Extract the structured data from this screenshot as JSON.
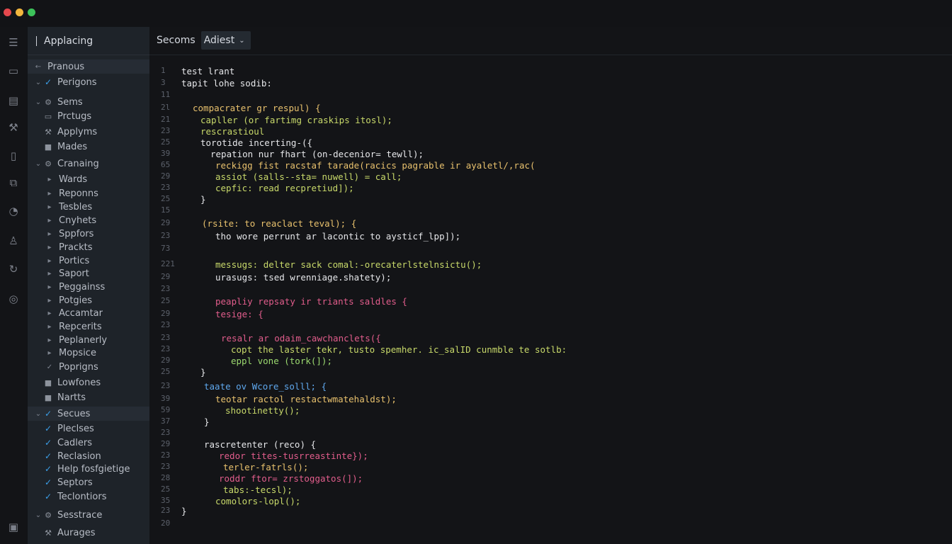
{
  "colors": {
    "close": "#e5484d",
    "minimize": "#f2b63d",
    "maximize": "#3cc25a",
    "accent": "#3b9fe8"
  },
  "sidebar": {
    "title": "Applacing",
    "items": [
      {
        "label": "Pranous",
        "glyph": "←",
        "check": false
      },
      {
        "label": "Perigons",
        "glyph": "⌄",
        "check": true
      },
      {
        "label": "Sems",
        "glyph": "⌄",
        "icon": "gear-icon"
      },
      {
        "label": "Prctugs",
        "icon": "folder-icon"
      },
      {
        "label": "Applyms",
        "icon": "wrench-icon"
      },
      {
        "label": "Mades",
        "icon": "box-icon"
      },
      {
        "label": "Cranaing",
        "glyph": "⌄",
        "icon": "gear-icon"
      },
      {
        "label": "Wards",
        "glyph": "▸"
      },
      {
        "label": "Reponns",
        "glyph": "▸"
      },
      {
        "label": "Tesbles",
        "glyph": "▸"
      },
      {
        "label": "Cnyhets",
        "glyph": "▸"
      },
      {
        "label": "Sppfors",
        "glyph": "▸"
      },
      {
        "label": "Prackts",
        "glyph": "▸"
      },
      {
        "label": "Portics",
        "glyph": "▸"
      },
      {
        "label": "Saport",
        "glyph": "▸"
      },
      {
        "label": "Peggainss",
        "glyph": "▸"
      },
      {
        "label": "Potgies",
        "glyph": "▸"
      },
      {
        "label": "Accamtar",
        "glyph": "▸"
      },
      {
        "label": "Repcerits",
        "glyph": "▸"
      },
      {
        "label": "Peplanerly",
        "glyph": "▸"
      },
      {
        "label": "Mopsice",
        "glyph": "▸"
      },
      {
        "label": "Poprigns",
        "glyph": "✓"
      },
      {
        "label": "Lowfones",
        "icon": "box-icon"
      },
      {
        "label": "Nartts",
        "icon": "box-icon"
      },
      {
        "label": "Secues",
        "glyph": "⌄",
        "check": true
      },
      {
        "label": "Pleclses",
        "check": true
      },
      {
        "label": "Cadlers",
        "check": true
      },
      {
        "label": "Reclasion",
        "check": true
      },
      {
        "label": "Help fosfgietige",
        "check": true
      },
      {
        "label": "Septors",
        "check": true
      },
      {
        "label": "Teclontiors",
        "check": true
      },
      {
        "label": "Sesstrace",
        "glyph": "⌄",
        "icon": "gear-icon"
      },
      {
        "label": "Aurages",
        "icon": "wrench-icon"
      }
    ]
  },
  "editor": {
    "tabs": [
      {
        "label": "Secoms"
      },
      {
        "label": "Adiest"
      }
    ],
    "lines": [
      {
        "n": "1",
        "t": "test lrant"
      },
      {
        "n": "3",
        "t": "tapit lohe sodib:"
      },
      {
        "n": "11",
        "t": ""
      },
      {
        "n": "2l",
        "t": "compacrater gr respul) {"
      },
      {
        "n": "21",
        "t": "capller (or fartimg craskips itosl);"
      },
      {
        "n": "23",
        "t": "rescrastioul"
      },
      {
        "n": "25",
        "t": "torotide incerting-({"
      },
      {
        "n": "39",
        "t": "repation nur fhart (on-decenior= tewll);"
      },
      {
        "n": "65",
        "t": "reckigg fist racstaf tarade(racics pagrable ir ayaletl/,rac("
      },
      {
        "n": "29",
        "t": "assiot (salls--sta= nuwell) = call;"
      },
      {
        "n": "23",
        "t": "cepfic: read recpretiud]);"
      },
      {
        "n": "25",
        "t": "}"
      },
      {
        "n": "15",
        "t": ""
      },
      {
        "n": "29",
        "t": "(rsite: to reaclact teval); {"
      },
      {
        "n": "23",
        "t": "tho wore perrunt ar lacontic to aysticf_lpp]);"
      },
      {
        "n": "73",
        "t": ""
      },
      {
        "n": "221",
        "t": "messugs: delter sack comal:-orecaterlstelnsictu();"
      },
      {
        "n": "29",
        "t": "urasugs: tsed wrenniage.shatety);"
      },
      {
        "n": "23",
        "t": ""
      },
      {
        "n": "25",
        "t": "peapliy repsaty ir triants saldles {"
      },
      {
        "n": "29",
        "t": "tesige: {"
      },
      {
        "n": "23",
        "t": ""
      },
      {
        "n": "23",
        "t": "resalr ar odaim_cawchanclets({"
      },
      {
        "n": "23",
        "t": "copt the laster tekr, tusto spemher. ic_salID cunmble te sotlb:"
      },
      {
        "n": "29",
        "t": "eppl vone (tork(]);"
      },
      {
        "n": "25",
        "t": "}"
      },
      {
        "n": "23",
        "t": "taate ov Wcore_solll; {"
      },
      {
        "n": "39",
        "t": "teotar ractol restactwmatehaldst);"
      },
      {
        "n": "59",
        "t": "shootinetty();"
      },
      {
        "n": "37",
        "t": "}"
      },
      {
        "n": "23",
        "t": ""
      },
      {
        "n": "29",
        "t": "rascretenter (reco) {"
      },
      {
        "n": "23",
        "t": "redor tites-tusrreastinte});"
      },
      {
        "n": "23",
        "t": "terler-fatrls();"
      },
      {
        "n": "28",
        "t": "roddr ftor= zrstoggatos(]);"
      },
      {
        "n": "25",
        "t": "tabs:-tecsl);"
      },
      {
        "n": "35",
        "t": "comolors-lopl();"
      },
      {
        "n": "23",
        "t": "}"
      },
      {
        "n": "20",
        "t": ""
      }
    ]
  }
}
